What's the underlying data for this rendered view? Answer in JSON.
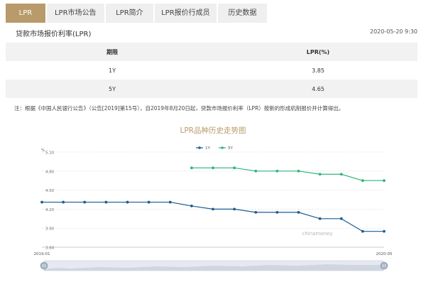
{
  "tabs": [
    {
      "label": "LPR",
      "active": true
    },
    {
      "label": "LPR市场公告",
      "active": false
    },
    {
      "label": "LPR简介",
      "active": false
    },
    {
      "label": "LPR报价行成员",
      "active": false
    },
    {
      "label": "历史数据",
      "active": false
    }
  ],
  "header": {
    "title": "贷款市场报价利率(LPR)",
    "date": "2020-05-20 9:30"
  },
  "table": {
    "headers": [
      "期限",
      "LPR(%)"
    ],
    "rows": [
      {
        "term": "1Y",
        "rate": "3.85"
      },
      {
        "term": "5Y",
        "rate": "4.65"
      }
    ]
  },
  "note": "注：根据《中国人民银行公告》（公告[2019]第15号），自2019年8月20日起，贷款市场报价利率（LPR）按新的形成机制报价并计算得出。",
  "colors": {
    "accent": "#b99a6a",
    "series_1y": "#1b5c96",
    "series_5y": "#2eb57b"
  },
  "chart_data": {
    "type": "line",
    "title": "LPR品种历史走势图",
    "ylabel": "%",
    "ylim": [
      3.6,
      5.1
    ],
    "yticks": [
      3.6,
      3.9,
      4.2,
      4.5,
      4.8,
      5.1
    ],
    "ytick_labels": [
      "3.60",
      "3.90",
      "4.20",
      "4.50",
      "4.80",
      "5.10"
    ],
    "x_start_label": "2019-01",
    "x_end_label": "2020-05",
    "watermark": "chinamoney",
    "legend_position": "top",
    "series": [
      {
        "name": "1Y",
        "color": "#1b5c96",
        "values": [
          4.31,
          4.31,
          4.31,
          4.31,
          4.31,
          4.31,
          4.31,
          4.25,
          4.2,
          4.2,
          4.15,
          4.15,
          4.15,
          4.05,
          4.05,
          3.85,
          3.85
        ]
      },
      {
        "name": "5Y",
        "color": "#2eb57b",
        "values": [
          null,
          null,
          null,
          null,
          null,
          null,
          null,
          4.85,
          4.85,
          4.85,
          4.8,
          4.8,
          4.8,
          4.75,
          4.75,
          4.65,
          4.65
        ]
      }
    ],
    "grid": true
  },
  "scrollbar": {
    "handle_left_icon": "drag-handle-icon",
    "handle_right_icon": "drag-handle-icon"
  }
}
